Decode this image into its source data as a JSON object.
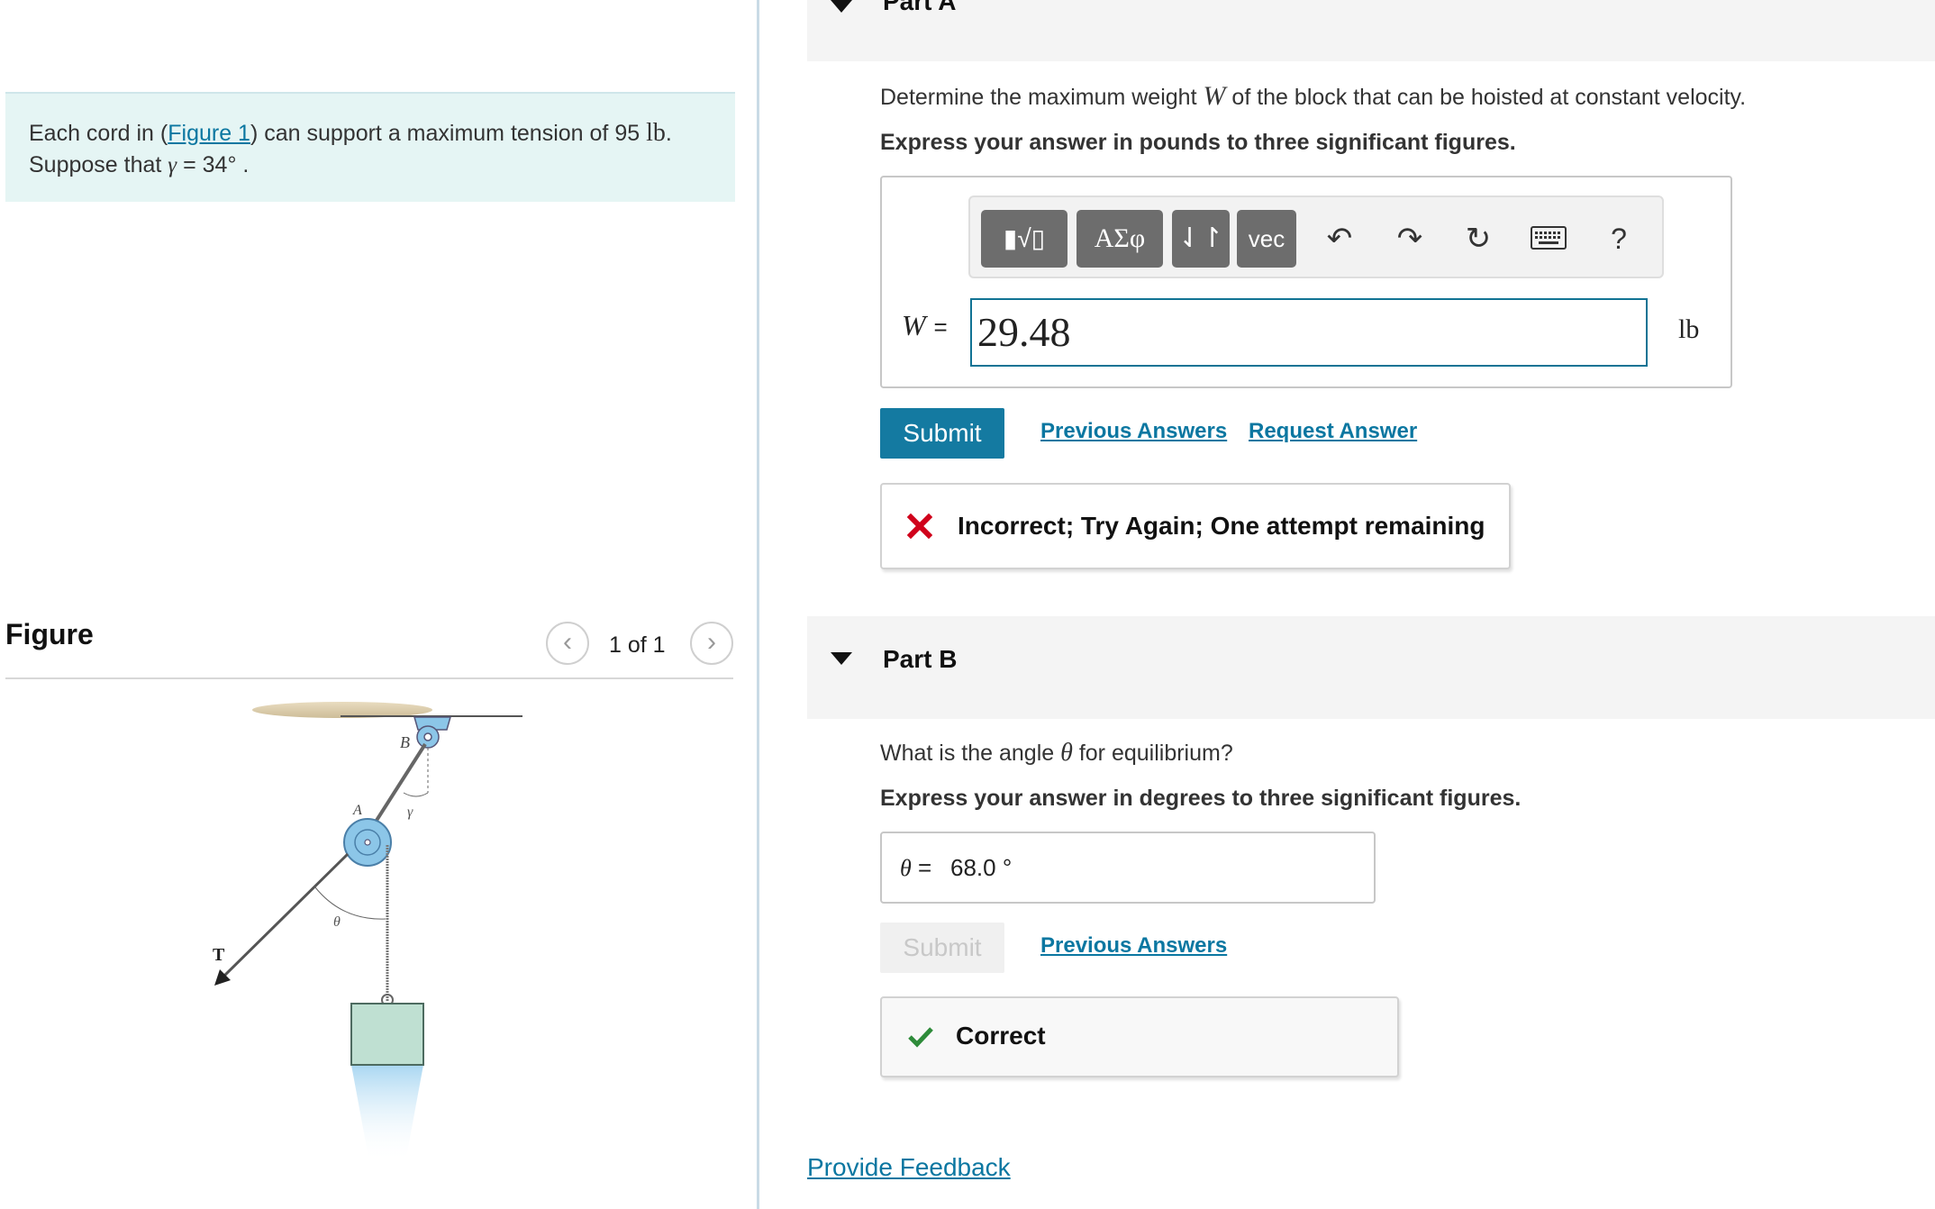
{
  "problem": {
    "text_before": "Each cord in (",
    "figure_link": "Figure 1",
    "text_after": ") can support a maximum tension of 95 ",
    "unit": "lb",
    "line2_prefix": "Suppose that ",
    "symbol": "γ",
    "equals_value": " = 34°",
    "line2_suffix": " ."
  },
  "figure": {
    "title": "Figure",
    "counter": "1 of 1",
    "prev_icon": "chevron-left-icon",
    "next_icon": "chevron-right-icon",
    "label_B": "B",
    "label_A": "A",
    "label_gamma": "γ",
    "label_theta": "θ",
    "label_T": "T"
  },
  "partA": {
    "title": "Part A",
    "question_prefix": "Determine the maximum weight ",
    "question_var": "W",
    "question_suffix": " of the block that can be hoisted at constant velocity.",
    "instruction": "Express your answer in pounds to three significant figures.",
    "toolbar": {
      "templates": "▮√▯",
      "greek": "ΑΣφ",
      "arrows": "⇃↾",
      "vec": "vec",
      "undo_icon": "undo-icon",
      "redo_icon": "redo-icon",
      "reset_icon": "reset-icon",
      "keyboard_icon": "keyboard-icon",
      "help": "?"
    },
    "var_label": "W",
    "equals": "=",
    "answer_value": "29.48",
    "unit": "lb",
    "submit": "Submit",
    "previous_answers": "Previous Answers",
    "request_answer": "Request Answer",
    "feedback": "Incorrect; Try Again; One attempt remaining",
    "feedback_icon": "x-icon",
    "feedback_color": "#d0021b"
  },
  "partB": {
    "title": "Part B",
    "question_prefix": "What is the angle ",
    "question_var": "θ",
    "question_suffix": " for equilibrium?",
    "instruction": "Express your answer in degrees to three significant figures.",
    "var_label": "θ",
    "equals": "=",
    "answer_value": "68.0 °",
    "submit": "Submit",
    "previous_answers": "Previous Answers",
    "feedback": "Correct",
    "feedback_icon": "check-icon",
    "feedback_color": "#2e8b3a"
  },
  "footer": {
    "provide_feedback": "Provide Feedback"
  },
  "colors": {
    "accent": "#147aa1",
    "link": "#0b77a1",
    "problem_bg": "#e5f5f4"
  }
}
